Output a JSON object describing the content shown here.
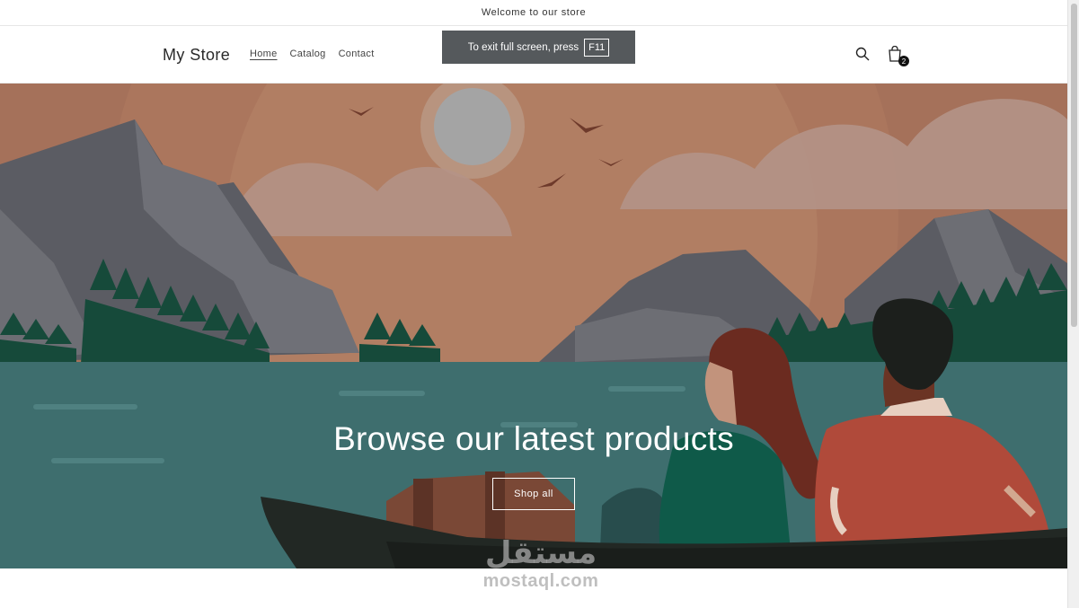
{
  "announcement": {
    "text": "Welcome to our store"
  },
  "header": {
    "logo": "My Store",
    "nav": [
      {
        "label": "Home",
        "active": true
      },
      {
        "label": "Catalog",
        "active": false
      },
      {
        "label": "Contact",
        "active": false
      }
    ],
    "icons": {
      "search": "search-icon",
      "cart": "cart-icon"
    },
    "cart_count": "2"
  },
  "fullscreen_toast": {
    "text": "To exit full screen, press",
    "key": "F11"
  },
  "hero": {
    "title": "Browse our latest products",
    "button_label": "Shop all"
  },
  "watermark": {
    "arabic": "مستقل",
    "latin": "mostaql.com"
  },
  "colors": {
    "sky": "#a5715a",
    "water": "#3e6e6e",
    "mountain": "#5b5c63",
    "trees": "#164a3a",
    "boat": "#222824"
  }
}
